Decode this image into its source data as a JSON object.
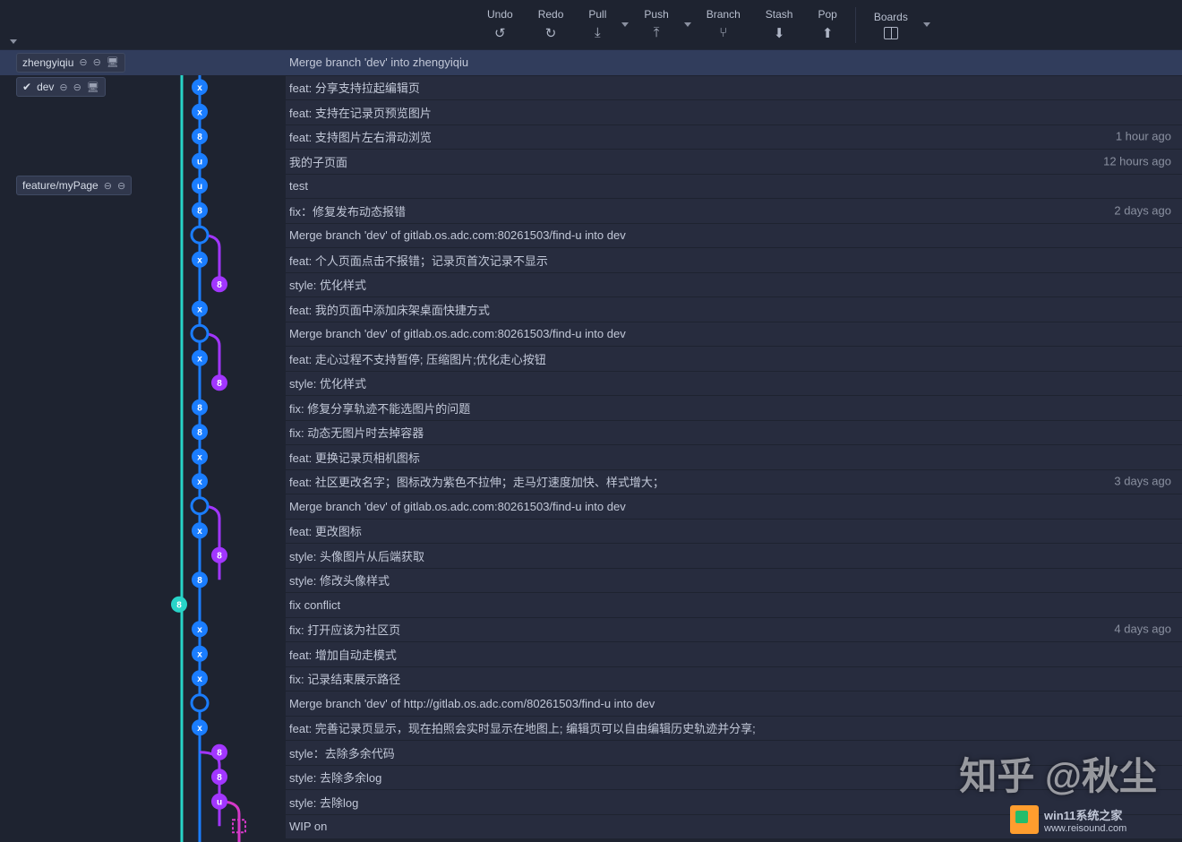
{
  "toolbar": {
    "undo": "Undo",
    "redo": "Redo",
    "pull": "Pull",
    "push": "Push",
    "branch": "Branch",
    "stash": "Stash",
    "pop": "Pop",
    "boards": "Boards"
  },
  "branches": {
    "zhengyiqiu": "zhengyiqiu",
    "dev": "dev",
    "feature_mypage": "feature/myPage"
  },
  "colors": {
    "teal": "#28d4c8",
    "blue": "#1a7dff",
    "purple": "#a236ff",
    "magenta": "#d538c8"
  },
  "commits": [
    {
      "lane": 0,
      "type": "head",
      "color": "teal",
      "msg": "Merge branch 'dev' into zhengyiqiu",
      "chip": "zhengyiqiu",
      "selected": true
    },
    {
      "lane": 1,
      "type": "x",
      "color": "blue",
      "msg": "feat: 分享支持拉起编辑页",
      "chip": "dev",
      "check": true
    },
    {
      "lane": 1,
      "type": "x",
      "color": "blue",
      "msg": "feat: 支持在记录页预览图片"
    },
    {
      "lane": 1,
      "type": "8",
      "color": "blue",
      "msg": "feat: 支持图片左右滑动浏览",
      "time": "1 hour ago"
    },
    {
      "lane": 1,
      "type": "u",
      "color": "blue",
      "msg": "我的子页面",
      "time": "12 hours ago"
    },
    {
      "lane": 1,
      "type": "u",
      "color": "blue",
      "msg": "test",
      "chip": "feature/myPage"
    },
    {
      "lane": 1,
      "type": "8",
      "color": "blue",
      "msg": "fix：修复发布动态报错",
      "time": "2 days ago"
    },
    {
      "lane": 1,
      "type": "merge",
      "color": "blue",
      "msg": "Merge branch 'dev' of gitlab.os.adc.com:80261503/find-u into dev"
    },
    {
      "lane": 1,
      "type": "x",
      "color": "blue",
      "msg": "feat: 个人页面点击不报错；记录页首次记录不显示"
    },
    {
      "lane": 2,
      "type": "8",
      "color": "purple",
      "msg": "style: 优化样式"
    },
    {
      "lane": 1,
      "type": "x",
      "color": "blue",
      "msg": "feat: 我的页面中添加床架桌面快捷方式"
    },
    {
      "lane": 1,
      "type": "merge",
      "color": "blue",
      "msg": "Merge branch 'dev' of gitlab.os.adc.com:80261503/find-u into dev"
    },
    {
      "lane": 1,
      "type": "x",
      "color": "blue",
      "msg": "feat: 走心过程不支持暂停; 压缩图片;优化走心按钮"
    },
    {
      "lane": 2,
      "type": "8",
      "color": "purple",
      "msg": "style: 优化样式"
    },
    {
      "lane": 1,
      "type": "8",
      "color": "blue",
      "msg": "fix: 修复分享轨迹不能选图片的问题"
    },
    {
      "lane": 1,
      "type": "8",
      "color": "blue",
      "msg": "fix: 动态无图片时去掉容器"
    },
    {
      "lane": 1,
      "type": "x",
      "color": "blue",
      "msg": "feat: 更换记录页相机图标"
    },
    {
      "lane": 1,
      "type": "x",
      "color": "blue",
      "msg": "feat: 社区更改名字；图标改为紫色不拉伸；走马灯速度加快、样式增大；",
      "time": "3 days ago"
    },
    {
      "lane": 1,
      "type": "merge",
      "color": "blue",
      "msg": "Merge branch 'dev' of gitlab.os.adc.com:80261503/find-u into dev"
    },
    {
      "lane": 1,
      "type": "x",
      "color": "blue",
      "msg": "feat: 更改图标"
    },
    {
      "lane": 2,
      "type": "8",
      "color": "purple",
      "msg": "style: 头像图片从后端获取"
    },
    {
      "lane": 1,
      "type": "8",
      "color": "blue",
      "msg": "style: 修改头像样式"
    },
    {
      "lane": -1,
      "type": "8",
      "color": "teal",
      "msg": "fix conflict"
    },
    {
      "lane": 1,
      "type": "x",
      "color": "blue",
      "msg": "fix: 打开应该为社区页",
      "time": "4 days ago"
    },
    {
      "lane": 1,
      "type": "x",
      "color": "blue",
      "msg": "feat: 增加自动走模式"
    },
    {
      "lane": 1,
      "type": "x",
      "color": "blue",
      "msg": "fix: 记录结束展示路径"
    },
    {
      "lane": 1,
      "type": "merge",
      "color": "blue",
      "msg": "Merge branch 'dev' of http://gitlab.os.adc.com/80261503/find-u into dev"
    },
    {
      "lane": 1,
      "type": "x",
      "color": "blue",
      "msg": "feat: 完善记录页显示，现在拍照会实时显示在地图上; 编辑页可以自由编辑历史轨迹并分享;"
    },
    {
      "lane": 2,
      "type": "8",
      "color": "purple",
      "msg": "style：去除多余代码"
    },
    {
      "lane": 2,
      "type": "8",
      "color": "purple",
      "msg": "style: 去除多余log"
    },
    {
      "lane": 2,
      "type": "u",
      "color": "purple",
      "msg": "style: 去除log"
    },
    {
      "lane": 3,
      "type": "wip",
      "color": "magenta",
      "msg": "WIP on"
    }
  ],
  "watermark": {
    "big": "知乎 @秋尘",
    "site_name": "win11系统之家",
    "site_url": "www.reisound.com"
  }
}
